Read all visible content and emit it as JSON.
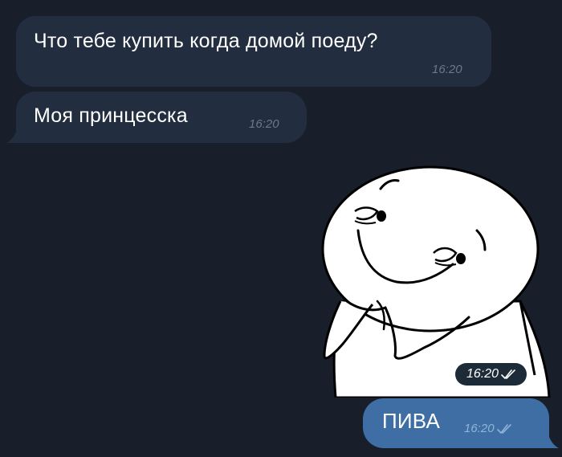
{
  "chat": {
    "messages": [
      {
        "direction": "incoming",
        "text": "Что тебе купить когда домой поеду?",
        "time": "16:20"
      },
      {
        "direction": "incoming",
        "text": "Моя принцесска",
        "time": "16:20"
      },
      {
        "direction": "outgoing",
        "type": "sticker",
        "sticker_icon": "smug-face-sticker",
        "time": "16:20",
        "status": "read"
      },
      {
        "direction": "outgoing",
        "text": "ПИВА",
        "time": "16:20",
        "status": "read"
      }
    ]
  },
  "colors": {
    "background": "#181f2a",
    "incoming_bubble": "#222e3f",
    "outgoing_bubble": "#3f6ea4",
    "incoming_time": "#6c7889",
    "outgoing_time": "#8fb3d9",
    "text": "#ffffff"
  }
}
